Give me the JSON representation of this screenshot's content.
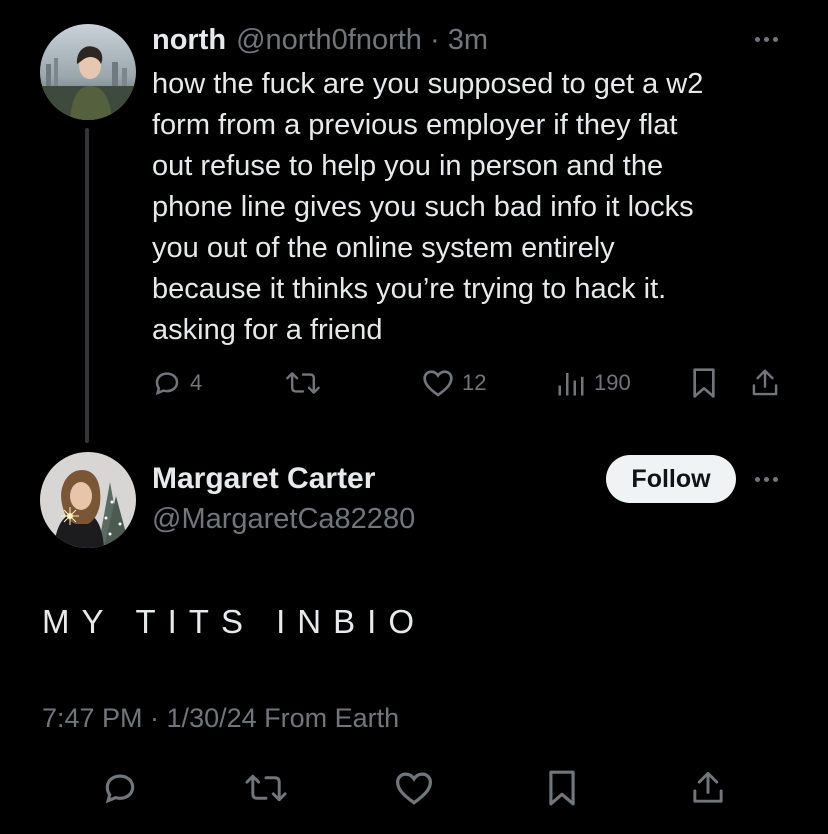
{
  "tweet": {
    "author": {
      "display_name": "north",
      "handle_and_time": "@north0fnorth · 3m"
    },
    "text": "how the fuck are you supposed to get a w2\nform from a previous employer if they flat\nout refuse to help you in person and the\nphone line gives you such bad info it locks\nyou out of the online system entirely\nbecause it thinks you’re trying to hack it.\nasking for a friend",
    "actions": {
      "reply_count": "4",
      "like_count": "12",
      "views_count": "190"
    }
  },
  "reply": {
    "author": {
      "display_name": "Margaret Carter",
      "handle": "@MargaretCa82280"
    },
    "follow_label": "Follow",
    "text": "MY TITS INBIO",
    "timestamp": "7:47 PM · 1/30/24 From Earth"
  },
  "colors": {
    "background": "#000000",
    "primary_text": "#e7e9ea",
    "secondary_text": "#71767b",
    "follow_button_bg": "#eff3f4"
  },
  "icons": [
    "reply-icon",
    "retweet-icon",
    "like-icon",
    "views-icon",
    "bookmark-icon",
    "share-icon",
    "more-icon"
  ]
}
